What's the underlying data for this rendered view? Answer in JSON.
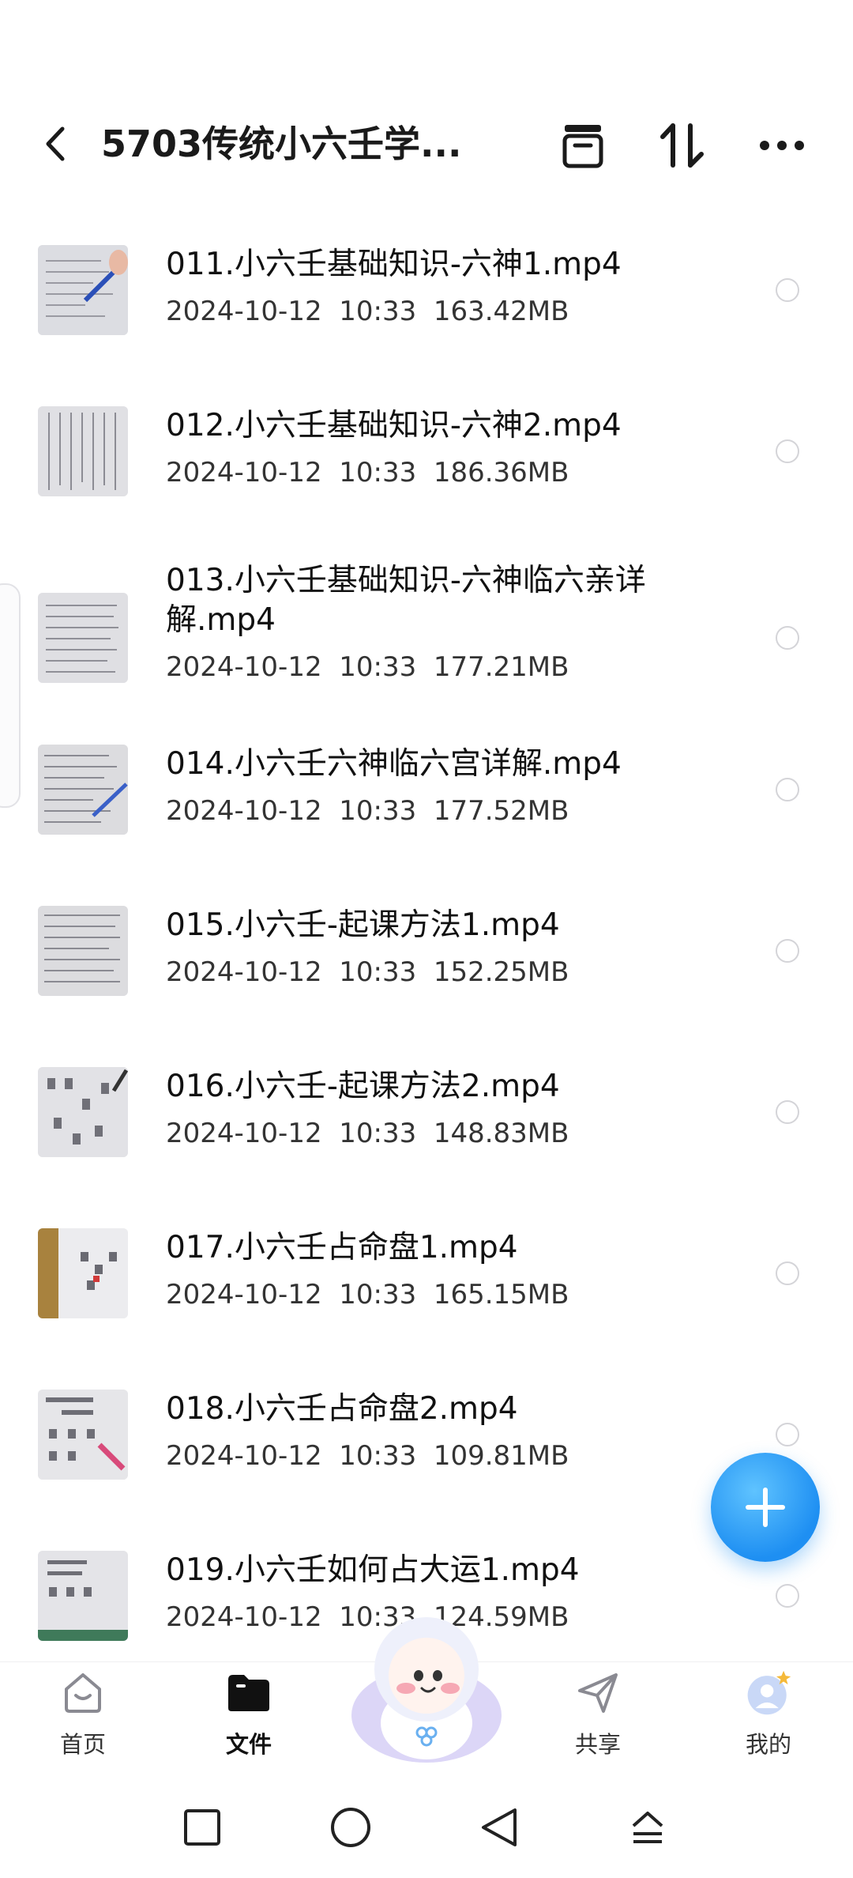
{
  "header": {
    "title": "5703传统小六壬学...",
    "icons": [
      "back-icon",
      "archive-box-icon",
      "sort-icon",
      "more-icon"
    ]
  },
  "files": [
    {
      "name": "011.小六壬基础知识-六神1.mp4",
      "date": "2024-10-12",
      "time": "10:33",
      "size": "163.42MB"
    },
    {
      "name": "012.小六壬基础知识-六神2.mp4",
      "date": "2024-10-12",
      "time": "10:33",
      "size": "186.36MB"
    },
    {
      "name": "013.小六壬基础知识-六神临六亲详解.mp4",
      "date": "2024-10-12",
      "time": "10:33",
      "size": "177.21MB"
    },
    {
      "name": "014.小六壬六神临六宫详解.mp4",
      "date": "2024-10-12",
      "time": "10:33",
      "size": "177.52MB"
    },
    {
      "name": "015.小六壬-起课方法1.mp4",
      "date": "2024-10-12",
      "time": "10:33",
      "size": "152.25MB"
    },
    {
      "name": "016.小六壬-起课方法2.mp4",
      "date": "2024-10-12",
      "time": "10:33",
      "size": "148.83MB"
    },
    {
      "name": "017.小六壬占命盘1.mp4",
      "date": "2024-10-12",
      "time": "10:33",
      "size": "165.15MB"
    },
    {
      "name": "018.小六壬占命盘2.mp4",
      "date": "2024-10-12",
      "time": "10:33",
      "size": "109.81MB"
    },
    {
      "name": "019.小六壬如何占大运1.mp4",
      "date": "2024-10-12",
      "time": "10:33",
      "size": "124.59MB"
    }
  ],
  "fab": {
    "icon": "plus-icon"
  },
  "tabbar": {
    "home": "首页",
    "files": "文件",
    "share": "共享",
    "mine": "我的",
    "active": "files"
  },
  "colors": {
    "accent": "#1e8ff2",
    "text_primary": "#111111",
    "text_secondary": "#333333",
    "radio_border": "#d4d4d8"
  }
}
